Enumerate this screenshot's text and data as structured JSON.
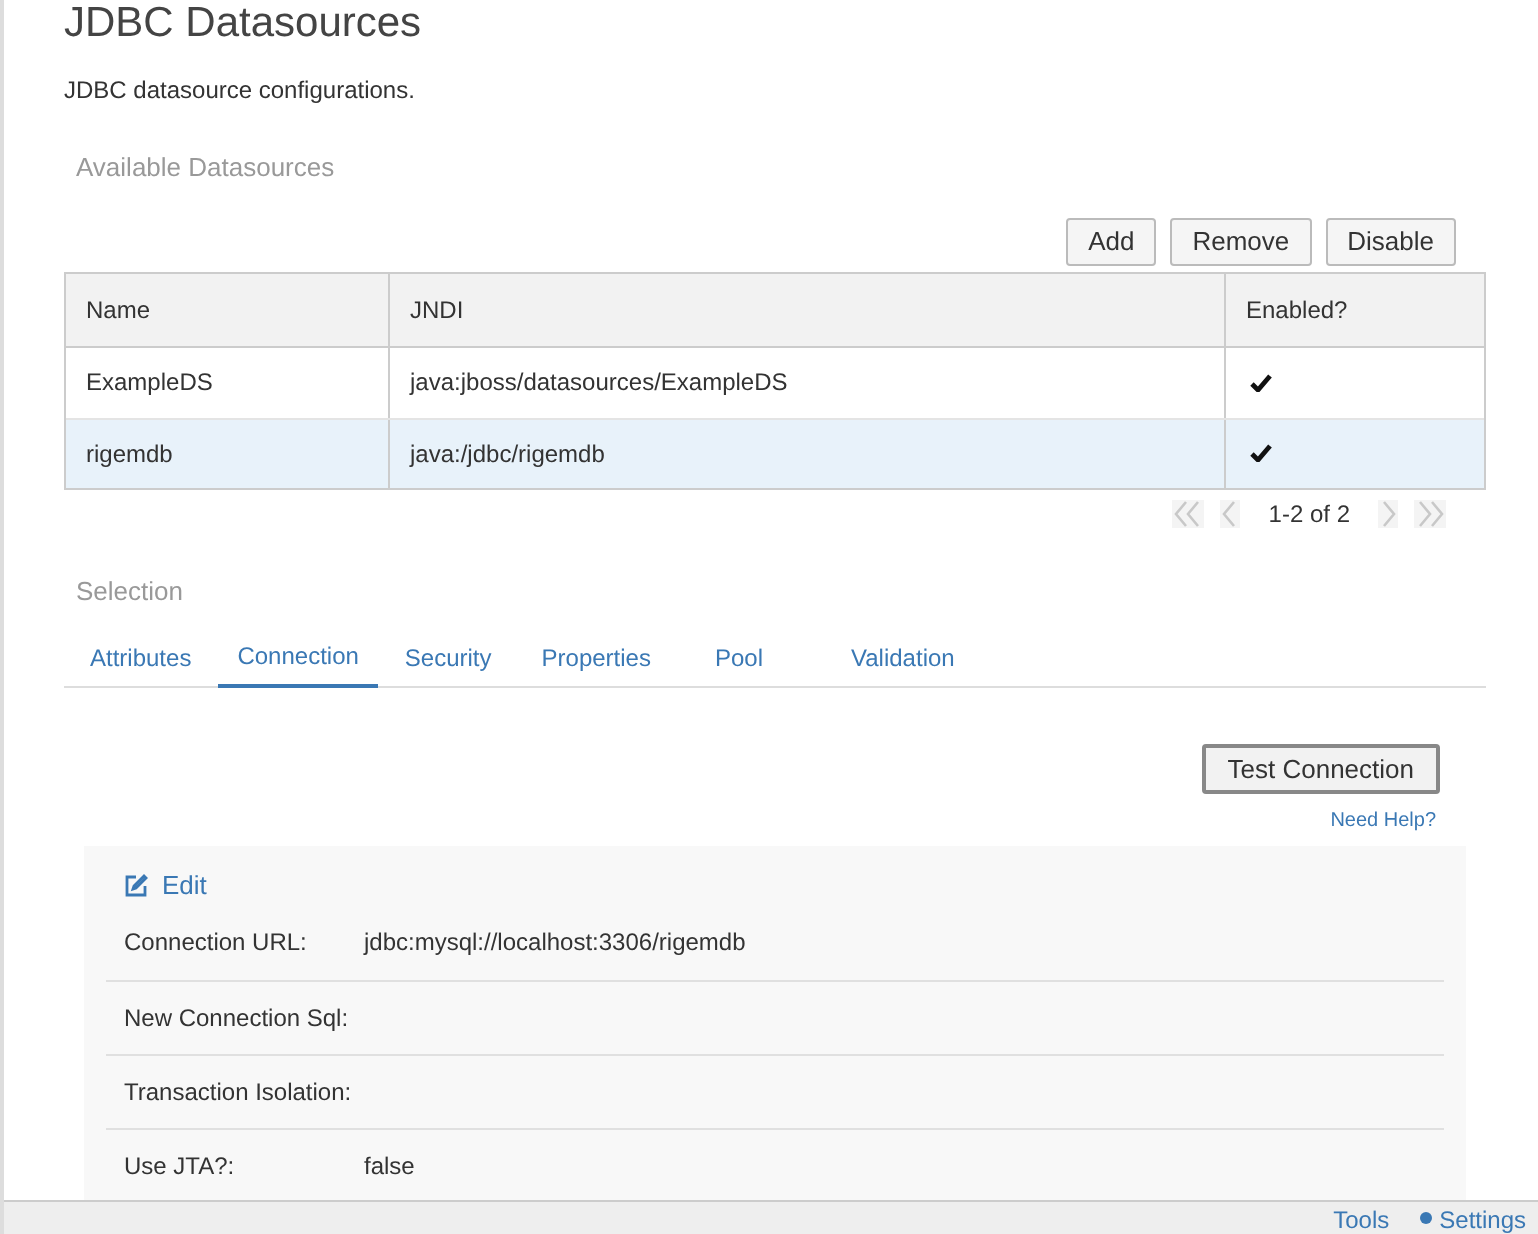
{
  "page": {
    "title": "JDBC Datasources",
    "description": "JDBC datasource configurations."
  },
  "datasources": {
    "heading": "Available Datasources",
    "buttons": [
      "Add",
      "Remove",
      "Disable"
    ],
    "columns": [
      "Name",
      "JNDI",
      "Enabled?"
    ],
    "rows": [
      {
        "name": "ExampleDS",
        "jndi": "java:jboss/datasources/ExampleDS",
        "enabled": true,
        "selected": false
      },
      {
        "name": "rigemdb",
        "jndi": "java:/jdbc/rigemdb",
        "enabled": true,
        "selected": true
      }
    ],
    "pager": "1-2 of 2"
  },
  "selection": {
    "heading": "Selection",
    "tabs": [
      {
        "label": "Attributes",
        "selected": false
      },
      {
        "label": "Connection",
        "selected": true
      },
      {
        "label": "Security",
        "selected": false
      },
      {
        "label": "Properties",
        "selected": false
      },
      {
        "label": "Pool",
        "selected": false
      },
      {
        "label": "Validation",
        "selected": false
      }
    ],
    "test_button": "Test Connection",
    "help_link": "Need Help?",
    "edit_link": "Edit",
    "fields": [
      {
        "label": "Connection URL:",
        "value": "jdbc:mysql://localhost:3306/rigemdb"
      },
      {
        "label": "New Connection Sql:"
      },
      {
        "label": "Transaction Isolation:"
      },
      {
        "label": "Use JTA?:",
        "value": "false"
      }
    ]
  },
  "footer": {
    "links": [
      "Tools",
      "Settings"
    ]
  }
}
